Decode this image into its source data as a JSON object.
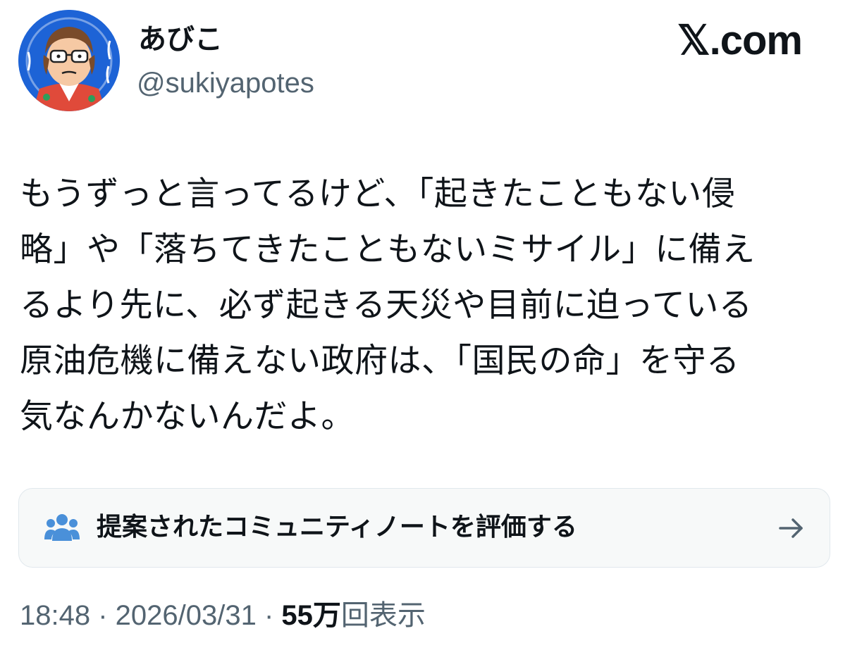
{
  "site": {
    "brand": "𝕏.com"
  },
  "author": {
    "display_name": "あびこ",
    "handle": "@sukiyapotes",
    "avatar_icon": "avatar-illustration-icon",
    "avatar_bg_color": "#1d63d6"
  },
  "tweet": {
    "lines": [
      "もうずっと言ってるけど、「起きたこともない侵",
      "略」や「落ちてきたこともないミサイル」に備え",
      "るより先に、必ず起きる天災や目前に迫っている",
      "原油危機に備えない政府は、「国民の命」を守る",
      "気なんかないんだよ。"
    ]
  },
  "community_note": {
    "label": "提案されたコミュニティノートを評価する",
    "people_icon": "people-icon",
    "people_icon_color": "#4a90d9",
    "arrow_icon": "arrow-right-icon"
  },
  "meta": {
    "time": "18:48",
    "separator": " · ",
    "date": "2026/03/31",
    "views_count": "55万",
    "views_label": "回表示"
  }
}
